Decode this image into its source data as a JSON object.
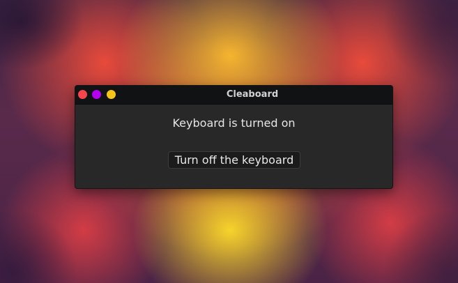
{
  "window": {
    "title": "Cleaboard",
    "controls": {
      "close_color": "#f6454c",
      "minimize_color": "#b300f0",
      "maximize_color": "#f5c518"
    }
  },
  "content": {
    "status_text": "Keyboard is turned on",
    "toggle_button_label": "Turn off the keyboard"
  }
}
